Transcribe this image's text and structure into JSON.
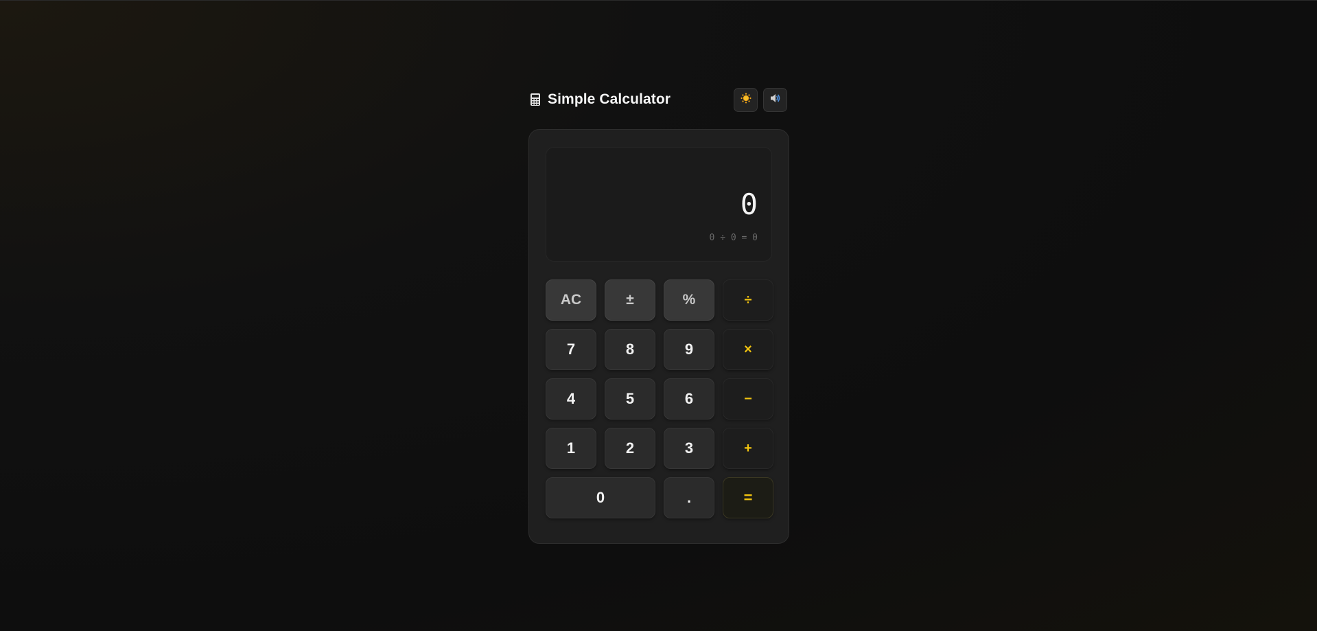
{
  "app": {
    "title": "Simple Calculator",
    "icon": "calculator-icon",
    "actions": [
      {
        "name": "theme-toggle",
        "icon": "sun-icon"
      },
      {
        "name": "sound-toggle",
        "icon": "speaker-icon"
      }
    ]
  },
  "display": {
    "value": "0",
    "expression": "0 ÷ 0 = 0"
  },
  "keys": {
    "ac": "AC",
    "sign": "±",
    "percent": "%",
    "divide": "÷",
    "seven": "7",
    "eight": "8",
    "nine": "9",
    "multiply": "×",
    "four": "4",
    "five": "5",
    "six": "6",
    "minus": "−",
    "one": "1",
    "two": "2",
    "three": "3",
    "plus": "+",
    "zero": "0",
    "decimal": ".",
    "equals": "="
  },
  "colors": {
    "accent": "#f2c40f",
    "background": "#111111",
    "card": "#1f1f1f"
  }
}
